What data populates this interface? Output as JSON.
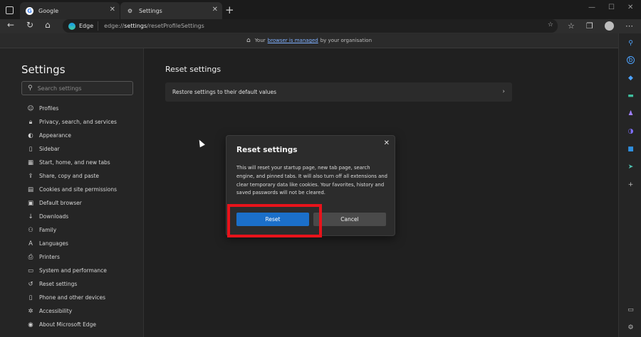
{
  "tabs": [
    {
      "title": "Google",
      "icon": "google-icon"
    },
    {
      "title": "Settings",
      "icon": "gear-icon"
    }
  ],
  "address": {
    "site_label": "Edge",
    "url_prefix": "edge://",
    "url_bold": "settings",
    "url_suffix": "/resetProfileSettings"
  },
  "managed_bar": {
    "prefix": "Your",
    "link": "browser is managed",
    "suffix": "by your organisation"
  },
  "sidebar": {
    "title": "Settings",
    "search_placeholder": "Search settings",
    "items": [
      {
        "label": "Profiles",
        "icon": "profile-icon"
      },
      {
        "label": "Privacy, search, and services",
        "icon": "lock-icon"
      },
      {
        "label": "Appearance",
        "icon": "palette-icon"
      },
      {
        "label": "Sidebar",
        "icon": "sidebar-icon"
      },
      {
        "label": "Start, home, and new tabs",
        "icon": "home-icon"
      },
      {
        "label": "Share, copy and paste",
        "icon": "share-icon"
      },
      {
        "label": "Cookies and site permissions",
        "icon": "cookie-icon"
      },
      {
        "label": "Default browser",
        "icon": "browser-icon"
      },
      {
        "label": "Downloads",
        "icon": "download-icon"
      },
      {
        "label": "Family",
        "icon": "family-icon"
      },
      {
        "label": "Languages",
        "icon": "language-icon"
      },
      {
        "label": "Printers",
        "icon": "printer-icon"
      },
      {
        "label": "System and performance",
        "icon": "system-icon"
      },
      {
        "label": "Reset settings",
        "icon": "reset-icon"
      },
      {
        "label": "Phone and other devices",
        "icon": "phone-icon"
      },
      {
        "label": "Accessibility",
        "icon": "accessibility-icon"
      },
      {
        "label": "About Microsoft Edge",
        "icon": "edge-icon"
      }
    ]
  },
  "main": {
    "title": "Reset settings",
    "row_label": "Restore settings to their default values"
  },
  "dialog": {
    "title": "Reset settings",
    "body": "This will reset your startup page, new tab page, search engine, and pinned tabs. It will also turn off all extensions and clear temporary data like cookies. Your favorites, history and saved passwords will not be cleared.",
    "reset_label": "Reset",
    "cancel_label": "Cancel"
  },
  "colors": {
    "accent": "#1b6fc9",
    "highlight": "#e8131b"
  }
}
